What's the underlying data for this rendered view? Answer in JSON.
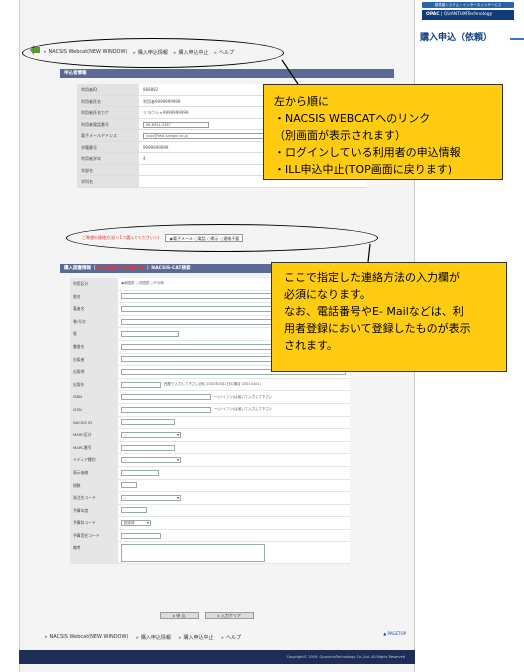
{
  "header": {
    "brand_strip": "図書館システム・インターネットサービス",
    "brand_opac": "OPAC",
    "brand_company": "QUANTUMTechnology",
    "page_title": "購入申込（依頼）"
  },
  "topnav": [
    "NACSIS Webcat(NEW WINDOW)",
    "購入申込情報",
    "購入申込中止",
    "ヘルプ"
  ],
  "section1": {
    "title": "申込者情報",
    "rows": [
      {
        "label": "利用者ID",
        "value": "888882"
      },
      {
        "label": "利用者氏名",
        "value": "利用者9999999999"
      },
      {
        "label": "利用者氏名カナ",
        "value": "リヨウシャ9999999999"
      },
      {
        "label": "利用者電話番号",
        "value": "06-6924-3387"
      },
      {
        "label": "電子メールアドレス",
        "value": "xxxx@test.sample.ac.jp"
      },
      {
        "label": "学籍番号",
        "value": "9999999999"
      },
      {
        "label": "利用者学年",
        "value": "4"
      },
      {
        "label": "学部名",
        "value": ""
      },
      {
        "label": "学科名",
        "value": ""
      }
    ]
  },
  "contact": {
    "label": "ご希望の連絡方法(＜1つ選んでください＞)",
    "options": [
      "電子メール",
      "電話",
      "掲示",
      "連絡不要"
    ]
  },
  "section2": {
    "title_prefix": "購入図書情報（",
    "title_req": "赤字は必須入力項目です。",
    "title_suffix": "）NACSIS-CAT検索",
    "rows": [
      {
        "label": "利用区分",
        "value": "◉和図書 ○洋図書 ○その他"
      },
      {
        "label": "書名",
        "value": ""
      },
      {
        "label": "著者名",
        "value": ""
      },
      {
        "label": "巻/号次",
        "value": ""
      },
      {
        "label": "版",
        "value": ""
      },
      {
        "label": "叢書名",
        "value": ""
      },
      {
        "label": "出版者",
        "value": ""
      },
      {
        "label": "出版地",
        "value": ""
      },
      {
        "label": "出版年",
        "value": "西暦で入力して下さい(例) 2001年4月1日の場合 20010401)"
      },
      {
        "label": "ISBN",
        "value": "ー(ハイフン)は省いて入力して下さい"
      },
      {
        "label": "ISSN",
        "value": "ー(ハイフン)は省いて入力して下さい"
      },
      {
        "label": "NACSIS ID",
        "value": ""
      },
      {
        "label": "MARC区分",
        "value": "--"
      },
      {
        "label": "MARC番号",
        "value": ""
      },
      {
        "label": "メディア種別",
        "value": "--"
      },
      {
        "label": "表示価格",
        "value": ""
      },
      {
        "label": "冊数",
        "value": ""
      },
      {
        "label": "発注先コード",
        "value": "--"
      },
      {
        "label": "予算年度",
        "value": ""
      },
      {
        "label": "予算科コード",
        "value": "図書費"
      },
      {
        "label": "予算責任コード",
        "value": ""
      },
      {
        "label": "備考",
        "value": ""
      }
    ]
  },
  "buttons": {
    "submit": "申 込",
    "clear": "入力クリア"
  },
  "pagetop": "PAGETOP",
  "bottomnav": [
    "NACSIS Webcat(NEW WINDOW)",
    "購入申込情報",
    "購入申込中止",
    "ヘルプ"
  ],
  "footer": "Copyright© 2009, QuantumTechnology Co.,Ltd. All Rights Reserved",
  "callout1": {
    "lines": [
      "左から順に",
      "・NACSIS WEBCATへのリンク",
      "（別画面が表示されます）",
      "・ログインしている利用者の申込情報",
      "・ILL申込中止(TOP画面に戻ります)"
    ]
  },
  "callout2": {
    "lines": [
      "ここで指定した連絡方法の入力欄が",
      "必須になります。",
      "なお、電話番号やE- Mailなどは、利",
      "用者登録において登録したものが表示",
      "されます。"
    ]
  }
}
